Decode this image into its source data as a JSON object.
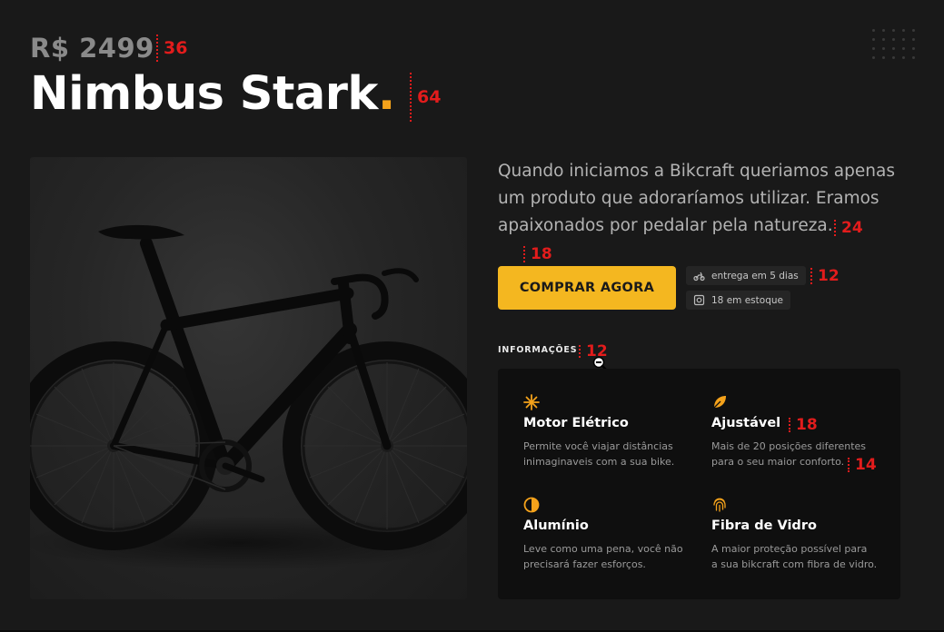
{
  "product": {
    "price": "R$ 2499",
    "name": "Nimbus Stark",
    "name_dot": ".",
    "description": "Quando iniciamos a Bikcraft queriamos apenas um produto que adoraríamos utilizar. Eramos apaixonados por pedalar pela natureza.",
    "buy_label": "COMPRAR AGORA",
    "delivery": "entrega em 5 dias",
    "stock": "18 em estoque",
    "accent_color": "#f4b720"
  },
  "info": {
    "label": "INFORMAÇÕES",
    "features": [
      {
        "name": "Motor Elétrico",
        "desc1": "Permite você viajar distâncias",
        "desc2": "inimaginaveis com a sua bike.",
        "icon": "snowflake-icon"
      },
      {
        "name": "Ajustável",
        "desc1": "Mais de 20 posições diferentes",
        "desc2": "para o seu maior conforto.",
        "icon": "leaf-icon"
      },
      {
        "name": "Alumínio",
        "desc1": "Leve como uma pena, você não",
        "desc2": "precisará fazer esforços.",
        "icon": "half-circle-icon"
      },
      {
        "name": "Fibra de Vidro",
        "desc1": "A maior proteção possível para",
        "desc2": "a sua bikcraft com fibra de vidro.",
        "icon": "fingerprint-icon"
      }
    ]
  },
  "annotations": {
    "price_size": "36",
    "title_size": "64",
    "desc_size": "24",
    "gap_18": "18",
    "pill_size": "12",
    "info_size": "12",
    "feat_name_size": "18",
    "feat_desc_size": "14"
  }
}
